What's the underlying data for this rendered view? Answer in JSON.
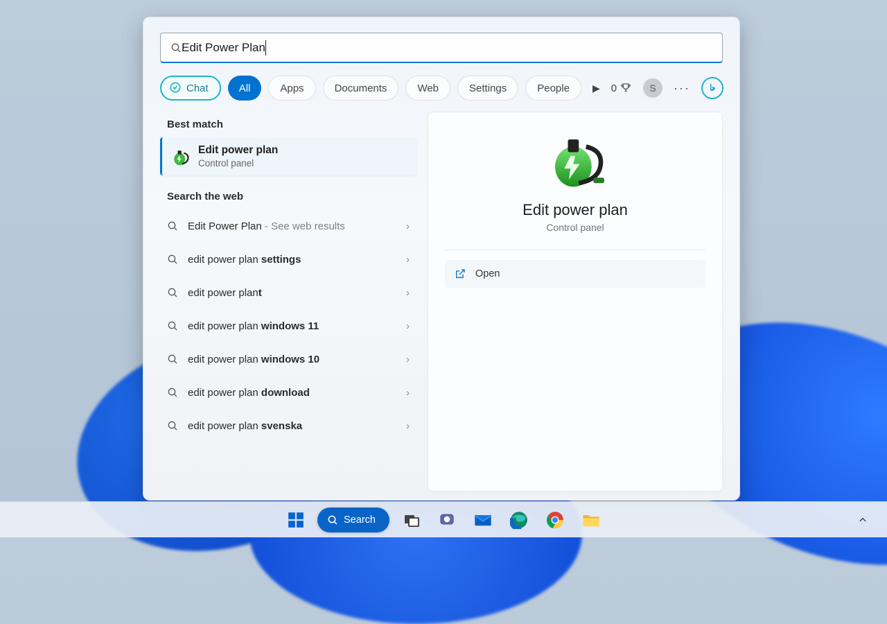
{
  "search": {
    "query": "Edit Power Plan",
    "filters": {
      "chat": "Chat",
      "all": "All",
      "apps": "Apps",
      "documents": "Documents",
      "web": "Web",
      "settings": "Settings",
      "people": "People"
    },
    "points": "0",
    "user_initial": "S"
  },
  "results": {
    "best_match_heading": "Best match",
    "best_match": {
      "title": "Edit power plan",
      "subtitle": "Control panel"
    },
    "web_heading": "Search the web",
    "web": [
      {
        "prefix": "Edit Power Plan",
        "bold": "",
        "suffix": " - See web results"
      },
      {
        "prefix": "edit power plan ",
        "bold": "settings",
        "suffix": ""
      },
      {
        "prefix": "edit power plan",
        "bold": "t",
        "suffix": ""
      },
      {
        "prefix": "edit power plan ",
        "bold": "windows 11",
        "suffix": ""
      },
      {
        "prefix": "edit power plan ",
        "bold": "windows 10",
        "suffix": ""
      },
      {
        "prefix": "edit power plan ",
        "bold": "download",
        "suffix": ""
      },
      {
        "prefix": "edit power plan ",
        "bold": "svenska",
        "suffix": ""
      }
    ]
  },
  "detail": {
    "title": "Edit power plan",
    "subtitle": "Control panel",
    "open_label": "Open"
  },
  "taskbar": {
    "search_label": "Search"
  }
}
